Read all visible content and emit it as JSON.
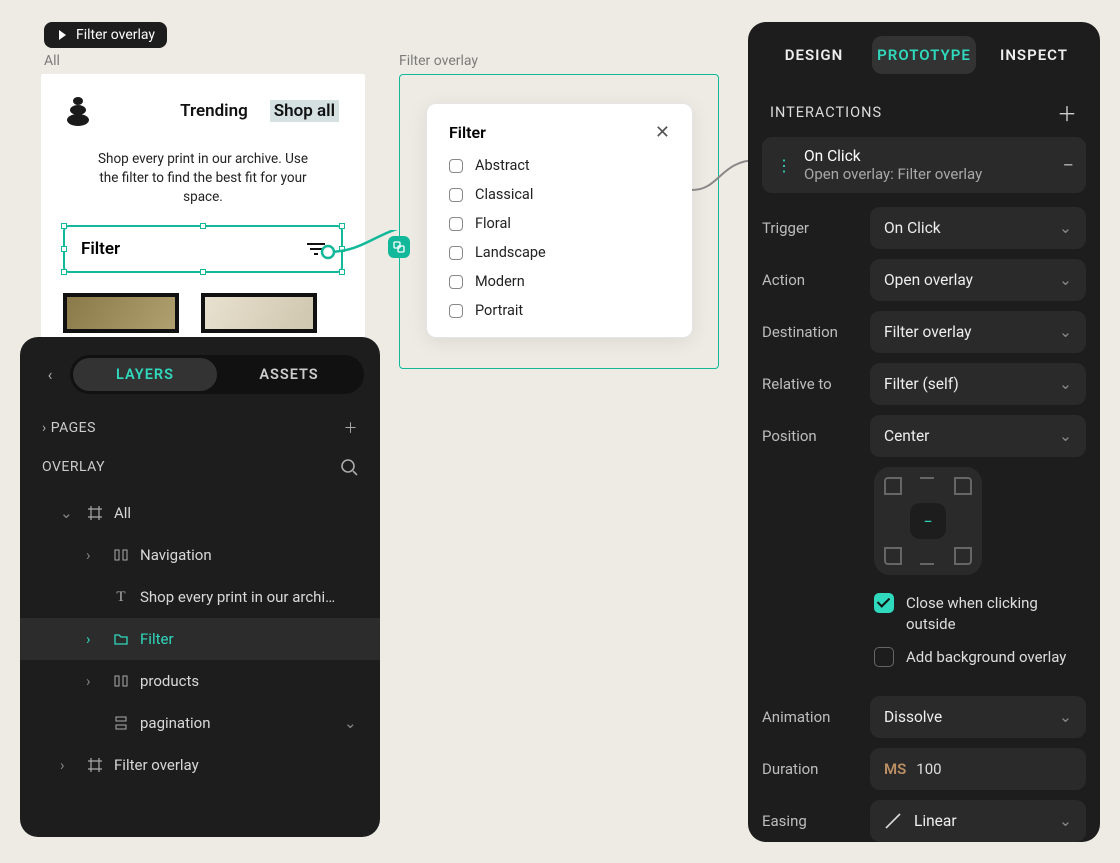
{
  "frame_chip": "Filter overlay",
  "labels": {
    "all": "All",
    "overlay": "Filter overlay"
  },
  "all_frame": {
    "nav": {
      "trending": "Trending",
      "shop_all": "Shop all"
    },
    "sub": "Shop every print in our archive. Use the filter to find the best fit for your space.",
    "filter_label": "Filter"
  },
  "overlay_frame": {
    "title": "Filter",
    "items": [
      "Abstract",
      "Classical",
      "Floral",
      "Landscape",
      "Modern",
      "Portrait"
    ]
  },
  "left_panel": {
    "tabs": {
      "layers": "LAYERS",
      "assets": "ASSETS"
    },
    "pages": "PAGES",
    "overlay_heading": "OVERLAY",
    "tree": {
      "all": "All",
      "navigation": "Navigation",
      "shop_text": "Shop every print in our archi…",
      "filter": "Filter",
      "products": "products",
      "pagination": "pagination",
      "filter_overlay": "Filter overlay"
    }
  },
  "right_panel": {
    "tabs": {
      "design": "DESIGN",
      "prototype": "PROTOTYPE",
      "inspect": "INSPECT"
    },
    "section": "INTERACTIONS",
    "card": {
      "title": "On Click",
      "sub": "Open overlay: Filter overlay"
    },
    "props": {
      "trigger_label": "Trigger",
      "trigger_val": "On Click",
      "action_label": "Action",
      "action_val": "Open overlay",
      "destination_label": "Destination",
      "destination_val": "Filter overlay",
      "relative_label": "Relative to",
      "relative_val": "Filter (self)",
      "position_label": "Position",
      "position_val": "Center",
      "close_outside": "Close when clicking outside",
      "bg_overlay": "Add background overlay",
      "animation_label": "Animation",
      "animation_val": "Dissolve",
      "duration_label": "Duration",
      "duration_unit": "MS",
      "duration_val": "100",
      "easing_label": "Easing",
      "easing_val": "Linear"
    }
  }
}
